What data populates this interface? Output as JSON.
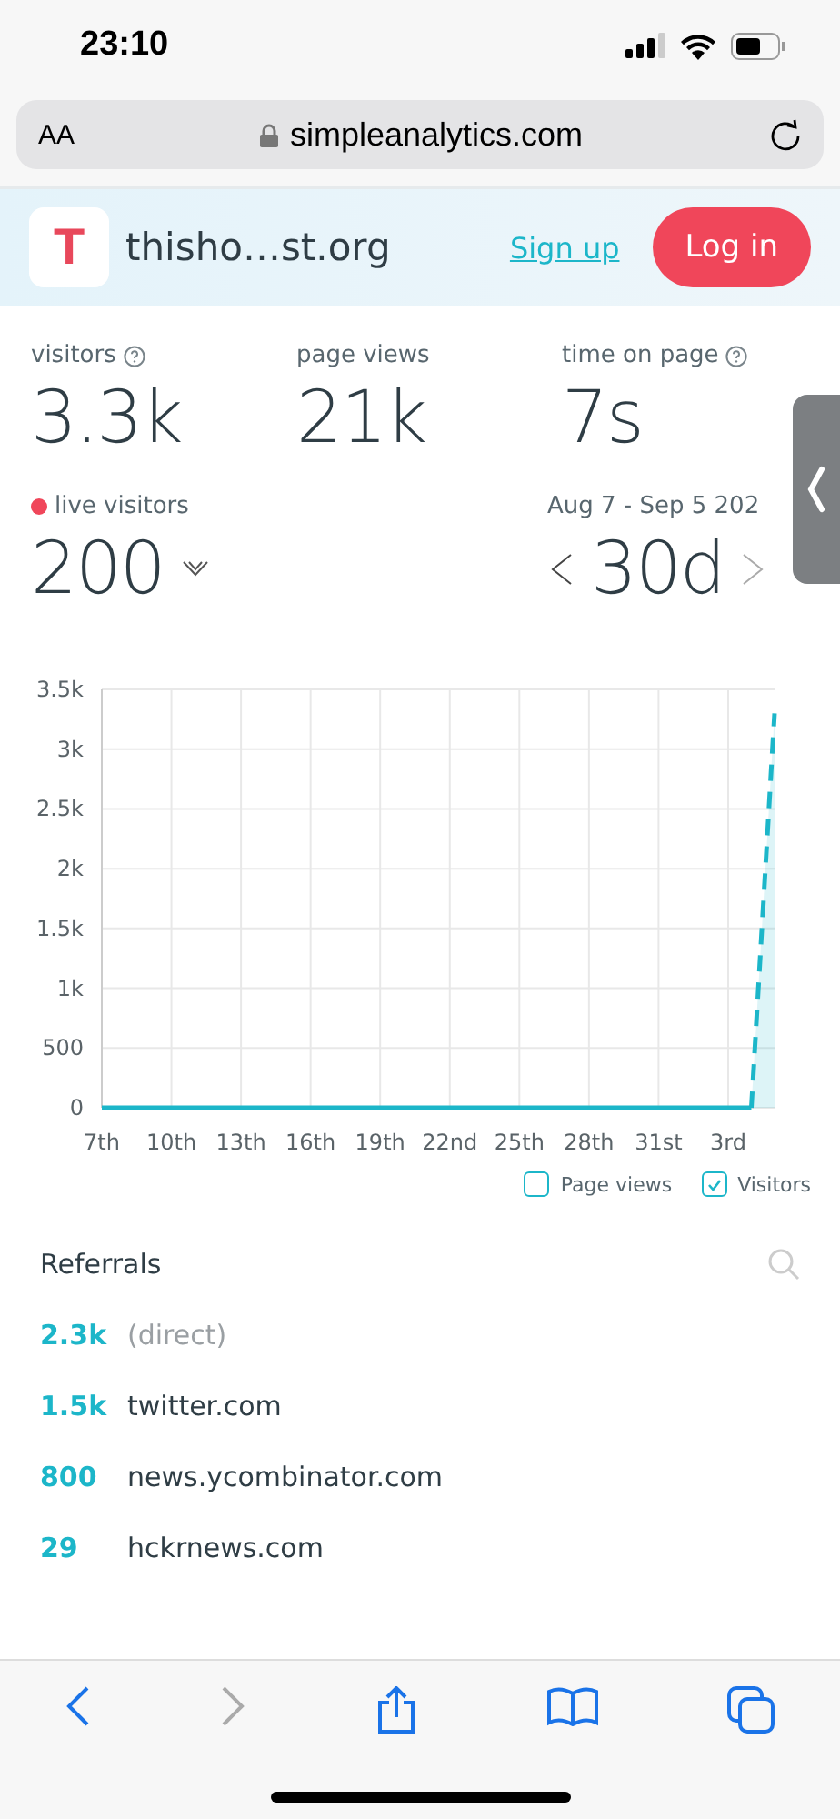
{
  "status_bar": {
    "time": "23:10"
  },
  "address_bar": {
    "text_size": "AA",
    "url": "simpleanalytics.com"
  },
  "header": {
    "logo_letter": "T",
    "site": "thisho…st.org",
    "sign_up": "Sign up",
    "log_in": "Log in"
  },
  "stats": [
    {
      "label": "visitors",
      "value": "3.3k",
      "help": true
    },
    {
      "label": "page views",
      "value": "21k",
      "help": false
    },
    {
      "label": "time on page",
      "value": "7s",
      "help": true
    }
  ],
  "live": {
    "label": "live visitors",
    "value": "200",
    "color": "#f0465a"
  },
  "period": {
    "range": "Aug 7 - Sep 5 202",
    "value": "30d"
  },
  "chart": {
    "chart_data": {
      "type": "line",
      "grid": true,
      "categories": [
        "7th",
        null,
        null,
        "10th",
        null,
        null,
        "13th",
        null,
        null,
        "16th",
        null,
        null,
        "19th",
        null,
        null,
        "22nd",
        null,
        null,
        "25th",
        null,
        null,
        "28th",
        null,
        null,
        "31st",
        null,
        null,
        "3rd",
        null,
        null
      ],
      "series": [
        {
          "name": "Visitors",
          "color": "#1cb6c9",
          "values": [
            0,
            0,
            0,
            0,
            0,
            0,
            0,
            0,
            0,
            0,
            0,
            0,
            0,
            0,
            0,
            0,
            0,
            0,
            0,
            0,
            0,
            0,
            0,
            0,
            0,
            0,
            0,
            0,
            0,
            3300
          ]
        }
      ],
      "ylim": [
        0,
        3500
      ],
      "yticks": [
        {
          "value": 0,
          "label": "0"
        },
        {
          "value": 500,
          "label": "500"
        },
        {
          "value": 1000,
          "label": "1k"
        },
        {
          "value": 1500,
          "label": "1.5k"
        },
        {
          "value": 2000,
          "label": "2k"
        },
        {
          "value": 2500,
          "label": "2.5k"
        },
        {
          "value": 3000,
          "label": "3k"
        },
        {
          "value": 3500,
          "label": "3.5k"
        }
      ]
    },
    "legend": [
      {
        "label": "Page views",
        "checked": false
      },
      {
        "kind": "series",
        "checked": true
      }
    ]
  },
  "referrals": {
    "title": "Referrals",
    "rows": [
      {
        "count": "2.3k",
        "source": "(direct)",
        "kind": "direct"
      },
      {
        "count": "1.5k",
        "source": "twitter.com",
        "kind": "site"
      },
      {
        "count": "800",
        "source": "news.ycombinator.com",
        "kind": "site"
      },
      {
        "count": "29",
        "source": "hckrnews.com",
        "kind": "site"
      }
    ]
  }
}
